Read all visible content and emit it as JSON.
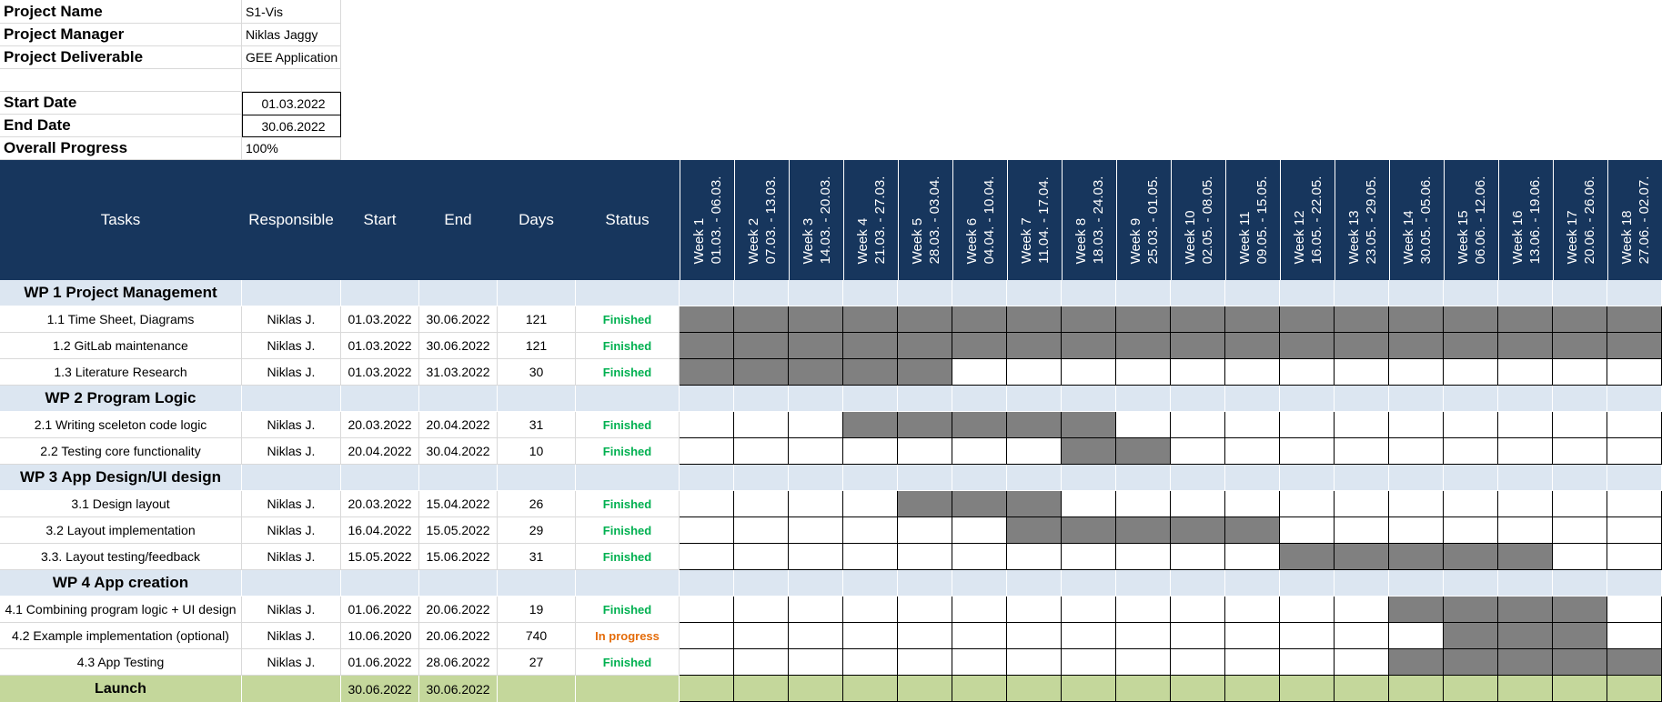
{
  "meta": {
    "project_name_label": "Project Name",
    "project_name": "S1-Vis",
    "project_manager_label": "Project Manager",
    "project_manager": "Niklas Jaggy",
    "project_deliverable_label": "Project Deliverable",
    "project_deliverable": "GEE Application",
    "start_date_label": "Start Date",
    "start_date": "01.03.2022",
    "end_date_label": "End Date",
    "end_date": "30.06.2022",
    "overall_progress_label": "Overall Progress",
    "overall_progress": "100%"
  },
  "headers": {
    "tasks": "Tasks",
    "responsible": "Responsible",
    "start": "Start",
    "end": "End",
    "days": "Days",
    "status": "Status"
  },
  "weeks": [
    {
      "label": "Week 1",
      "range": "01.03. - 06.03."
    },
    {
      "label": "Week 2",
      "range": "07.03. - 13.03."
    },
    {
      "label": "Week 3",
      "range": "14.03. - 20.03."
    },
    {
      "label": "Week 4",
      "range": "21.03. - 27.03."
    },
    {
      "label": "Week 5",
      "range": "28.03. - 03.04."
    },
    {
      "label": "Week 6",
      "range": "04.04. - 10.04."
    },
    {
      "label": "Week 7",
      "range": "11.04. - 17.04."
    },
    {
      "label": "Week 8",
      "range": "18.03. - 24.03."
    },
    {
      "label": "Week 9",
      "range": "25.03. - 01.05."
    },
    {
      "label": "Week 10",
      "range": "02.05. - 08.05."
    },
    {
      "label": "Week 11",
      "range": "09.05. - 15.05."
    },
    {
      "label": "Week 12",
      "range": "16.05. - 22.05."
    },
    {
      "label": "Week 13",
      "range": "23.05. - 29.05."
    },
    {
      "label": "Week 14",
      "range": "30.05. - 05.06."
    },
    {
      "label": "Week 15",
      "range": "06.06. - 12.06."
    },
    {
      "label": "Week 16",
      "range": "13.06. - 19.06."
    },
    {
      "label": "Week 17",
      "range": "20.06. - 26.06."
    },
    {
      "label": "Week 18",
      "range": "27.06. - 02.07."
    }
  ],
  "colors": {
    "header_bg": "#17365d",
    "workpackage_bg": "#dce6f1",
    "bar_fill": "#808080",
    "launch_bg": "#c4d79b",
    "finished": "#00b050",
    "in_progress": "#e46c0a"
  },
  "rows": [
    {
      "type": "wp",
      "title": "WP 1 Project Management"
    },
    {
      "type": "task",
      "title": "1.1 Time Sheet, Diagrams",
      "responsible": "Niklas J.",
      "start": "01.03.2022",
      "end": "30.06.2022",
      "days": "121",
      "status": "Finished",
      "bar": [
        1,
        1,
        1,
        1,
        1,
        1,
        1,
        1,
        1,
        1,
        1,
        1,
        1,
        1,
        1,
        1,
        1,
        1
      ]
    },
    {
      "type": "task",
      "title": "1.2 GitLab maintenance",
      "responsible": "Niklas J.",
      "start": "01.03.2022",
      "end": "30.06.2022",
      "days": "121",
      "status": "Finished",
      "bar": [
        1,
        1,
        1,
        1,
        1,
        1,
        1,
        1,
        1,
        1,
        1,
        1,
        1,
        1,
        1,
        1,
        1,
        1
      ]
    },
    {
      "type": "task",
      "title": "1.3 Literature Research",
      "responsible": "Niklas J.",
      "start": "01.03.2022",
      "end": "31.03.2022",
      "days": "30",
      "status": "Finished",
      "bar": [
        1,
        1,
        1,
        1,
        1,
        0,
        0,
        0,
        0,
        0,
        0,
        0,
        0,
        0,
        0,
        0,
        0,
        0
      ]
    },
    {
      "type": "wp",
      "title": "WP 2 Program Logic"
    },
    {
      "type": "task",
      "title": "2.1 Writing sceleton code logic",
      "responsible": "Niklas J.",
      "start": "20.03.2022",
      "end": "20.04.2022",
      "days": "31",
      "status": "Finished",
      "bar": [
        0,
        0,
        0,
        1,
        1,
        1,
        1,
        1,
        0,
        0,
        0,
        0,
        0,
        0,
        0,
        0,
        0,
        0
      ]
    },
    {
      "type": "task",
      "title": "2.2 Testing core functionality",
      "responsible": "Niklas J.",
      "start": "20.04.2022",
      "end": "30.04.2022",
      "days": "10",
      "status": "Finished",
      "bar": [
        0,
        0,
        0,
        0,
        0,
        0,
        0,
        1,
        1,
        0,
        0,
        0,
        0,
        0,
        0,
        0,
        0,
        0
      ]
    },
    {
      "type": "wp",
      "title": "WP 3 App Design/UI design"
    },
    {
      "type": "task",
      "title": "3.1 Design layout",
      "responsible": "Niklas J.",
      "start": "20.03.2022",
      "end": "15.04.2022",
      "days": "26",
      "status": "Finished",
      "bar": [
        0,
        0,
        0,
        0,
        1,
        1,
        1,
        0,
        0,
        0,
        0,
        0,
        0,
        0,
        0,
        0,
        0,
        0
      ]
    },
    {
      "type": "task",
      "title": "3.2 Layout implementation",
      "responsible": "Niklas J.",
      "start": "16.04.2022",
      "end": "15.05.2022",
      "days": "29",
      "status": "Finished",
      "bar": [
        0,
        0,
        0,
        0,
        0,
        0,
        1,
        1,
        1,
        1,
        1,
        0,
        0,
        0,
        0,
        0,
        0,
        0
      ]
    },
    {
      "type": "task",
      "title": "3.3. Layout testing/feedback",
      "responsible": "Niklas J.",
      "start": "15.05.2022",
      "end": "15.06.2022",
      "days": "31",
      "status": "Finished",
      "bar": [
        0,
        0,
        0,
        0,
        0,
        0,
        0,
        0,
        0,
        0,
        0,
        1,
        1,
        1,
        1,
        1,
        0,
        0
      ]
    },
    {
      "type": "wp",
      "title": "WP 4 App creation"
    },
    {
      "type": "task",
      "title": "4.1 Combining program logic + UI design",
      "responsible": "Niklas J.",
      "start": "01.06.2022",
      "end": "20.06.2022",
      "days": "19",
      "status": "Finished",
      "bar": [
        0,
        0,
        0,
        0,
        0,
        0,
        0,
        0,
        0,
        0,
        0,
        0,
        0,
        1,
        1,
        1,
        1,
        0
      ]
    },
    {
      "type": "task",
      "title": "4.2 Example implementation (optional)",
      "responsible": "Niklas J.",
      "start": "10.06.2020",
      "end": "20.06.2022",
      "days": "740",
      "status": "In progress",
      "bar": [
        0,
        0,
        0,
        0,
        0,
        0,
        0,
        0,
        0,
        0,
        0,
        0,
        0,
        0,
        1,
        1,
        1,
        0
      ]
    },
    {
      "type": "task",
      "title": "4.3 App Testing",
      "responsible": "Niklas J.",
      "start": "01.06.2022",
      "end": "28.06.2022",
      "days": "27",
      "status": "Finished",
      "bar": [
        0,
        0,
        0,
        0,
        0,
        0,
        0,
        0,
        0,
        0,
        0,
        0,
        0,
        1,
        1,
        1,
        1,
        1
      ]
    },
    {
      "type": "launch",
      "title": "Launch",
      "start": "30.06.2022",
      "end": "30.06.2022"
    }
  ]
}
